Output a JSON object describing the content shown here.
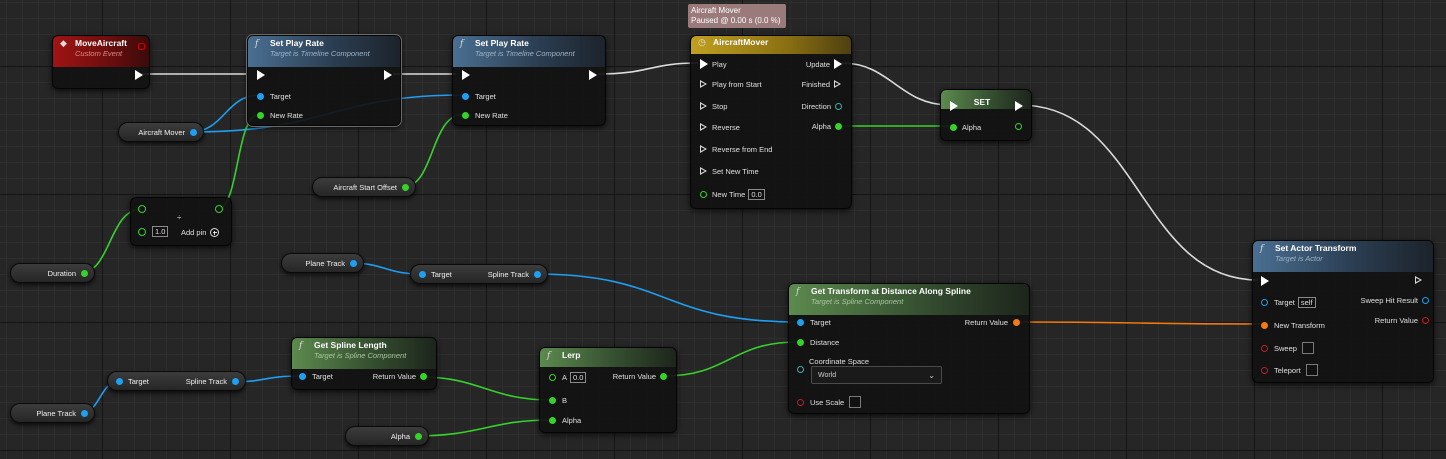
{
  "tooltip": {
    "title": "Aircraft Mover",
    "status": "Paused @ 0.00 s (0.0 %)"
  },
  "nodes": {
    "move_aircraft": {
      "title": "MoveAircraft",
      "subtitle": "Custom Event"
    },
    "set_play_rate_1": {
      "title": "Set Play Rate",
      "subtitle": "Target is Timeline Component",
      "target": "Target",
      "new_rate": "New Rate"
    },
    "set_play_rate_2": {
      "title": "Set Play Rate",
      "subtitle": "Target is Timeline Component",
      "target": "Target",
      "new_rate": "New Rate"
    },
    "aircraft_mover": {
      "title": "AircraftMover",
      "inputs": [
        "Play",
        "Play from Start",
        "Stop",
        "Reverse",
        "Reverse from End",
        "Set New Time"
      ],
      "new_time_label": "New Time",
      "new_time_value": "0.0",
      "outputs": {
        "update": "Update",
        "finished": "Finished",
        "direction": "Direction",
        "alpha": "Alpha"
      }
    },
    "set": {
      "title": "SET",
      "alpha": "Alpha"
    },
    "divide": {
      "value": "1.0",
      "add_pin": "Add pin",
      "op": "÷"
    },
    "get_transform": {
      "title": "Get Transform at Distance Along Spline",
      "subtitle": "Target is Spline Component",
      "target": "Target",
      "distance": "Distance",
      "coord_label": "Coordinate Space",
      "coord_value": "World",
      "use_scale": "Use Scale",
      "return_value": "Return Value"
    },
    "set_actor_transform": {
      "title": "Set Actor Transform",
      "subtitle": "Target is Actor",
      "target": "Target",
      "target_value": "self",
      "new_transform": "New Transform",
      "sweep": "Sweep",
      "teleport": "Teleport",
      "sweep_hit": "Sweep Hit Result",
      "return_value": "Return Value"
    },
    "get_spline_length": {
      "title": "Get Spline Length",
      "subtitle": "Target is Spline Component",
      "target": "Target",
      "return_value": "Return Value"
    },
    "lerp": {
      "title": "Lerp",
      "a": "A",
      "a_value": "0.0",
      "b": "B",
      "alpha": "Alpha",
      "return_value": "Return Value"
    },
    "spline_track_1": {
      "target": "Target",
      "output": "Spline Track"
    },
    "spline_track_2": {
      "target": "Target",
      "output": "Spline Track"
    }
  },
  "variables": {
    "aircraft_mover": "Aircraft Mover",
    "aircraft_start_offset": "Aircraft Start Offset",
    "duration": "Duration",
    "plane_track_1": "Plane Track",
    "plane_track_2": "Plane Track",
    "alpha": "Alpha"
  },
  "colors": {
    "exec": "#ffffff",
    "object": "#1e9ff2",
    "float": "#36d22b",
    "transform": "#f27a10",
    "bool": "#c11f1f"
  }
}
